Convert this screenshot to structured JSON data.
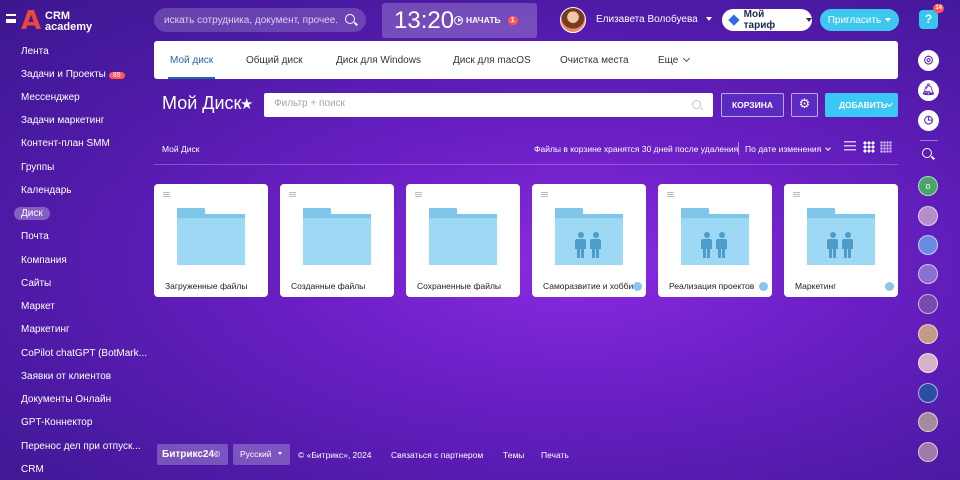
{
  "header": {
    "logo_line1": "CRM",
    "logo_line2": "academy",
    "search_placeholder": "искать сотрудника, документ, прочее...",
    "clock": "13:20",
    "start_label": "НАЧАТЬ",
    "start_badge": "1",
    "user_name": "Елизавета Волобуева",
    "tariff_label": "Мой тариф",
    "invite_label": "Пригласить",
    "help_label": "?",
    "help_badge": "14"
  },
  "sidebar": {
    "items": [
      {
        "label": "Лента"
      },
      {
        "label": "Задачи и Проекты",
        "badge": "89"
      },
      {
        "label": "Мессенджер"
      },
      {
        "label": "Задачи маркетинг"
      },
      {
        "label": "Контент-план SMM"
      },
      {
        "label": "Группы"
      },
      {
        "label": "Календарь"
      },
      {
        "label": "Диск",
        "active": true
      },
      {
        "label": "Почта"
      },
      {
        "label": "Компания"
      },
      {
        "label": "Сайты"
      },
      {
        "label": "Маркет"
      },
      {
        "label": "Маркетинг"
      },
      {
        "label": "CoPilot chatGPT (BotMark..."
      },
      {
        "label": "Заявки от клиентов"
      },
      {
        "label": "Документы Онлайн"
      },
      {
        "label": "GPT-Коннектор"
      },
      {
        "label": "Перенос дел при отпуск..."
      },
      {
        "label": "CRM"
      }
    ]
  },
  "tabs": {
    "items": [
      "Мой диск",
      "Общий диск",
      "Диск для Windows",
      "Диск для macOS",
      "Очистка места",
      "Еще"
    ]
  },
  "page": {
    "title": "Мой Диск",
    "star": "★",
    "filter_placeholder": "Фильтр + поиск",
    "bin_label": "КОРЗИНА",
    "settings_icon": "⚙",
    "add_label": "ДОБАВИТЬ",
    "breadcrumb": "Мой Диск",
    "bin_info": "Файлы в корзине хранятся 30 дней после удаления",
    "sort_label": "По дате изменения"
  },
  "folders": [
    {
      "label": "Загруженные файлы",
      "shared": false
    },
    {
      "label": "Созданные файлы",
      "shared": false
    },
    {
      "label": "Сохраненные файлы",
      "shared": false
    },
    {
      "label": "Саморазвитие и хобби",
      "shared": true
    },
    {
      "label": "Реализация проектов",
      "shared": true
    },
    {
      "label": "Маркетинг",
      "shared": true
    }
  ],
  "footer": {
    "brand": "Битрикс24",
    "brand_mark": "©",
    "language": "Русский",
    "copyright": "© «Битрикс», 2024",
    "partner_link": "Связаться с партнером",
    "themes_link": "Темы",
    "print_link": "Печать"
  },
  "right_bar": {
    "icons": [
      "copilot-icon",
      "notifications-icon",
      "timeline-icon",
      "search-icon"
    ],
    "avatar_initial": "о"
  },
  "colors": {
    "accent": "#2067b0",
    "invite": "#3ec8f0",
    "badge": "#ff5752",
    "folder": "#9dd8f5"
  }
}
